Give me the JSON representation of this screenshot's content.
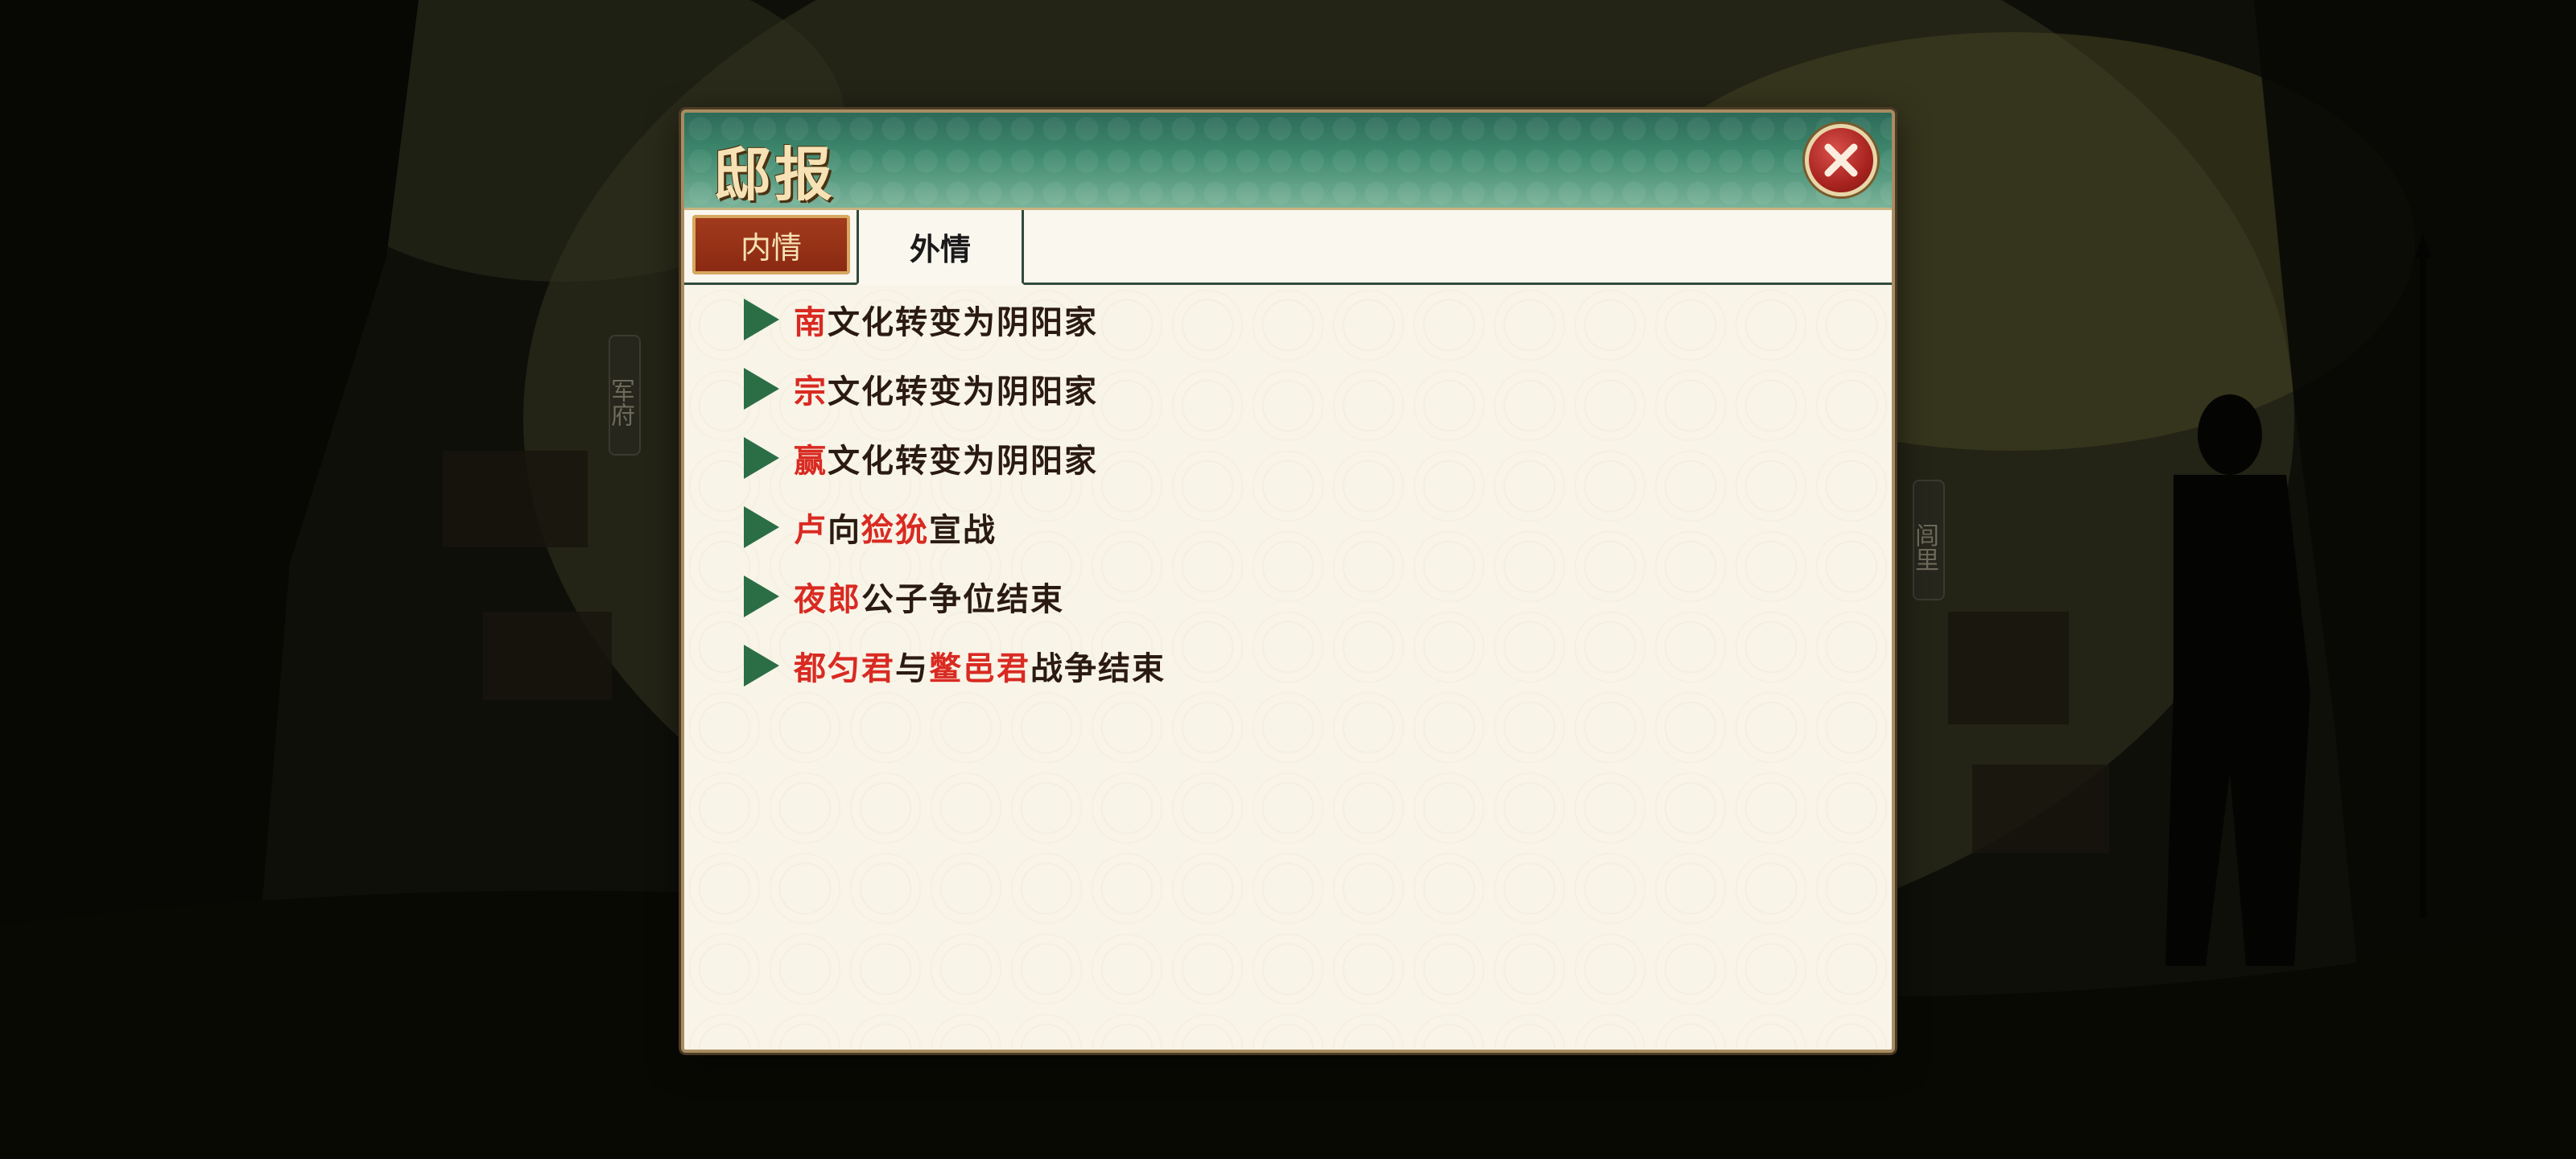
{
  "window": {
    "title": "邸报",
    "close_icon": "close-icon"
  },
  "tabs": [
    {
      "label": "内情",
      "active": false
    },
    {
      "label": "外情",
      "active": true
    }
  ],
  "side_tags": {
    "left": "军府",
    "right": "闾里"
  },
  "news": [
    {
      "parts": [
        {
          "text": "南",
          "highlight": true
        },
        {
          "text": "文化转变为阴阳家",
          "highlight": false
        }
      ]
    },
    {
      "parts": [
        {
          "text": "宗",
          "highlight": true
        },
        {
          "text": "文化转变为阴阳家",
          "highlight": false
        }
      ]
    },
    {
      "parts": [
        {
          "text": "赢",
          "highlight": true
        },
        {
          "text": "文化转变为阴阳家",
          "highlight": false
        }
      ]
    },
    {
      "parts": [
        {
          "text": "卢",
          "highlight": true
        },
        {
          "text": "向",
          "highlight": false
        },
        {
          "text": "猃狁",
          "highlight": true
        },
        {
          "text": "宣战",
          "highlight": false
        }
      ]
    },
    {
      "parts": [
        {
          "text": "夜郎",
          "highlight": true
        },
        {
          "text": "公子争位结束",
          "highlight": false
        }
      ]
    },
    {
      "parts": [
        {
          "text": "都匀君",
          "highlight": true
        },
        {
          "text": "与",
          "highlight": false
        },
        {
          "text": "鳖邑君",
          "highlight": true
        },
        {
          "text": "战争结束",
          "highlight": false
        }
      ]
    }
  ],
  "colors": {
    "highlight": "#d92a22",
    "text": "#2a1a12",
    "arrow": "#2b6e46",
    "header": "#3f8a6f",
    "tab_active": "#8a2a12"
  }
}
